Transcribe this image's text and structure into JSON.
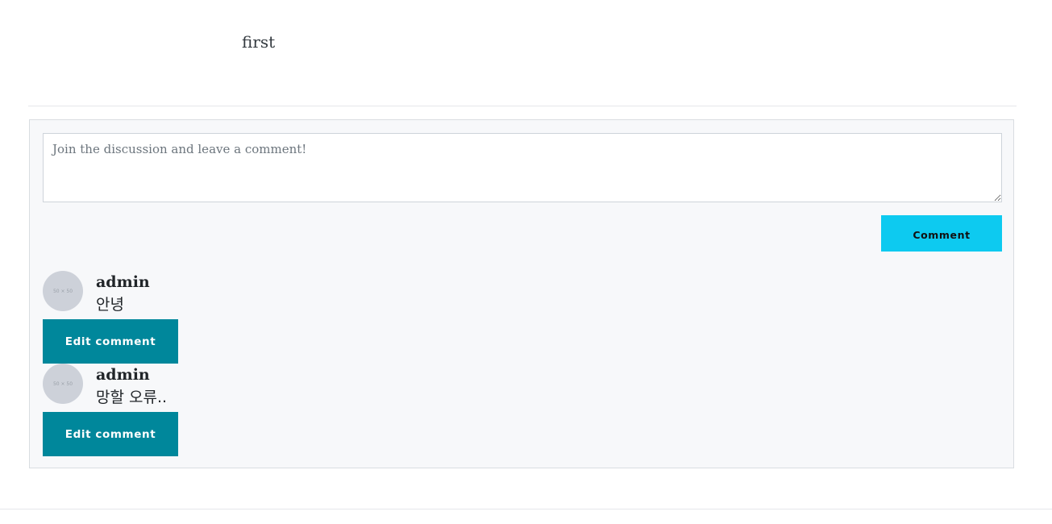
{
  "post": {
    "body": "first"
  },
  "comment_form": {
    "placeholder": "Join the discussion and leave a comment!",
    "value": "",
    "submit_label": "Comment"
  },
  "comments": [
    {
      "avatar_text": "50 × 50",
      "author": "admin",
      "text": "안녕",
      "edit_label": "Edit comment"
    },
    {
      "avatar_text": "50 × 50",
      "author": "admin",
      "text": "망할 오류..",
      "edit_label": "Edit comment"
    }
  ],
  "colors": {
    "submit_button": "#0dcaf0",
    "edit_button": "#00879b",
    "panel_background": "#f7f8fa"
  }
}
